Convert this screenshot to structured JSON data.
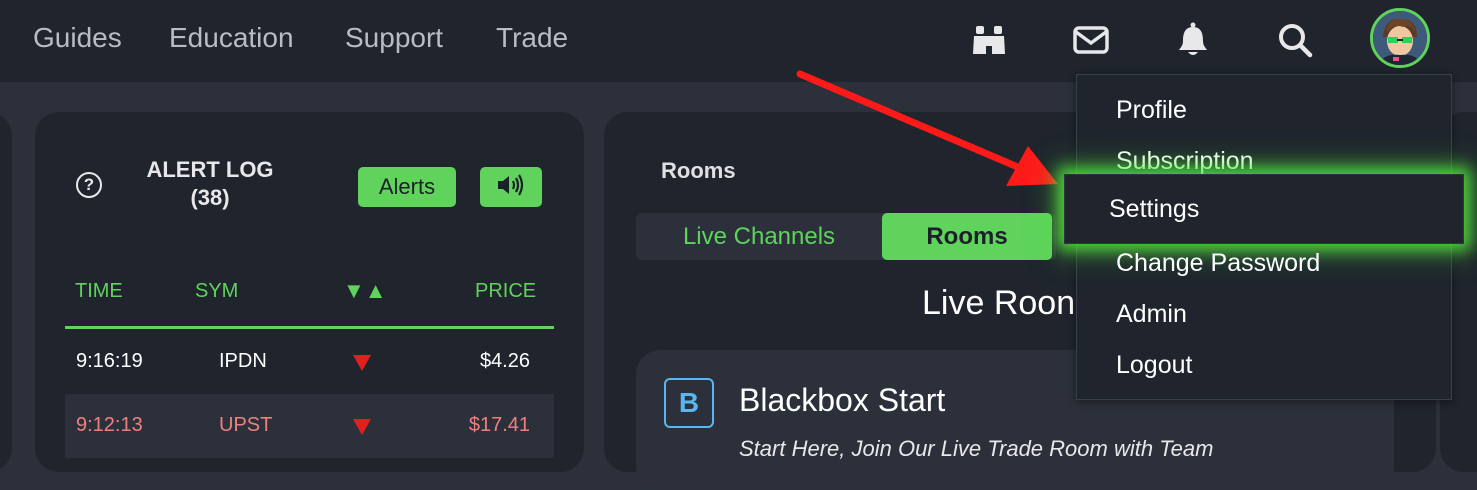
{
  "nav": {
    "links": [
      "Guides",
      "Education",
      "Support",
      "Trade"
    ],
    "icons": [
      "binoculars-icon",
      "mail-icon",
      "bell-icon",
      "search-icon"
    ]
  },
  "alert_log": {
    "title_line1": "ALERT LOG",
    "title_line2": "(38)",
    "help_glyph": "?",
    "alerts_button": "Alerts",
    "columns": {
      "time": "TIME",
      "sym": "SYM",
      "dir": "▼▲",
      "price": "PRICE"
    },
    "rows": [
      {
        "time": "9:16:19",
        "sym": "IPDN",
        "price": "$4.26",
        "highlight": false
      },
      {
        "time": "9:12:13",
        "sym": "UPST",
        "price": "$17.41",
        "highlight": true
      }
    ]
  },
  "rooms": {
    "label": "Rooms",
    "tabs": [
      "Live Channels",
      "Rooms"
    ],
    "active_tab": "Rooms",
    "heading": "Live Roon",
    "card": {
      "badge": "B",
      "name": "Blackbox Start",
      "description": "Start Here, Join Our Live Trade Room with Team"
    }
  },
  "user_menu": {
    "items": [
      "Profile",
      "Subscription",
      "Settings",
      "Change Password",
      "Admin",
      "Logout"
    ],
    "highlighted": "Settings"
  },
  "colors": {
    "accent_green": "#5fd35c",
    "down_red": "#e0201d",
    "alert_row_text": "#f08080",
    "annotation_arrow": "#ff1a1a"
  }
}
